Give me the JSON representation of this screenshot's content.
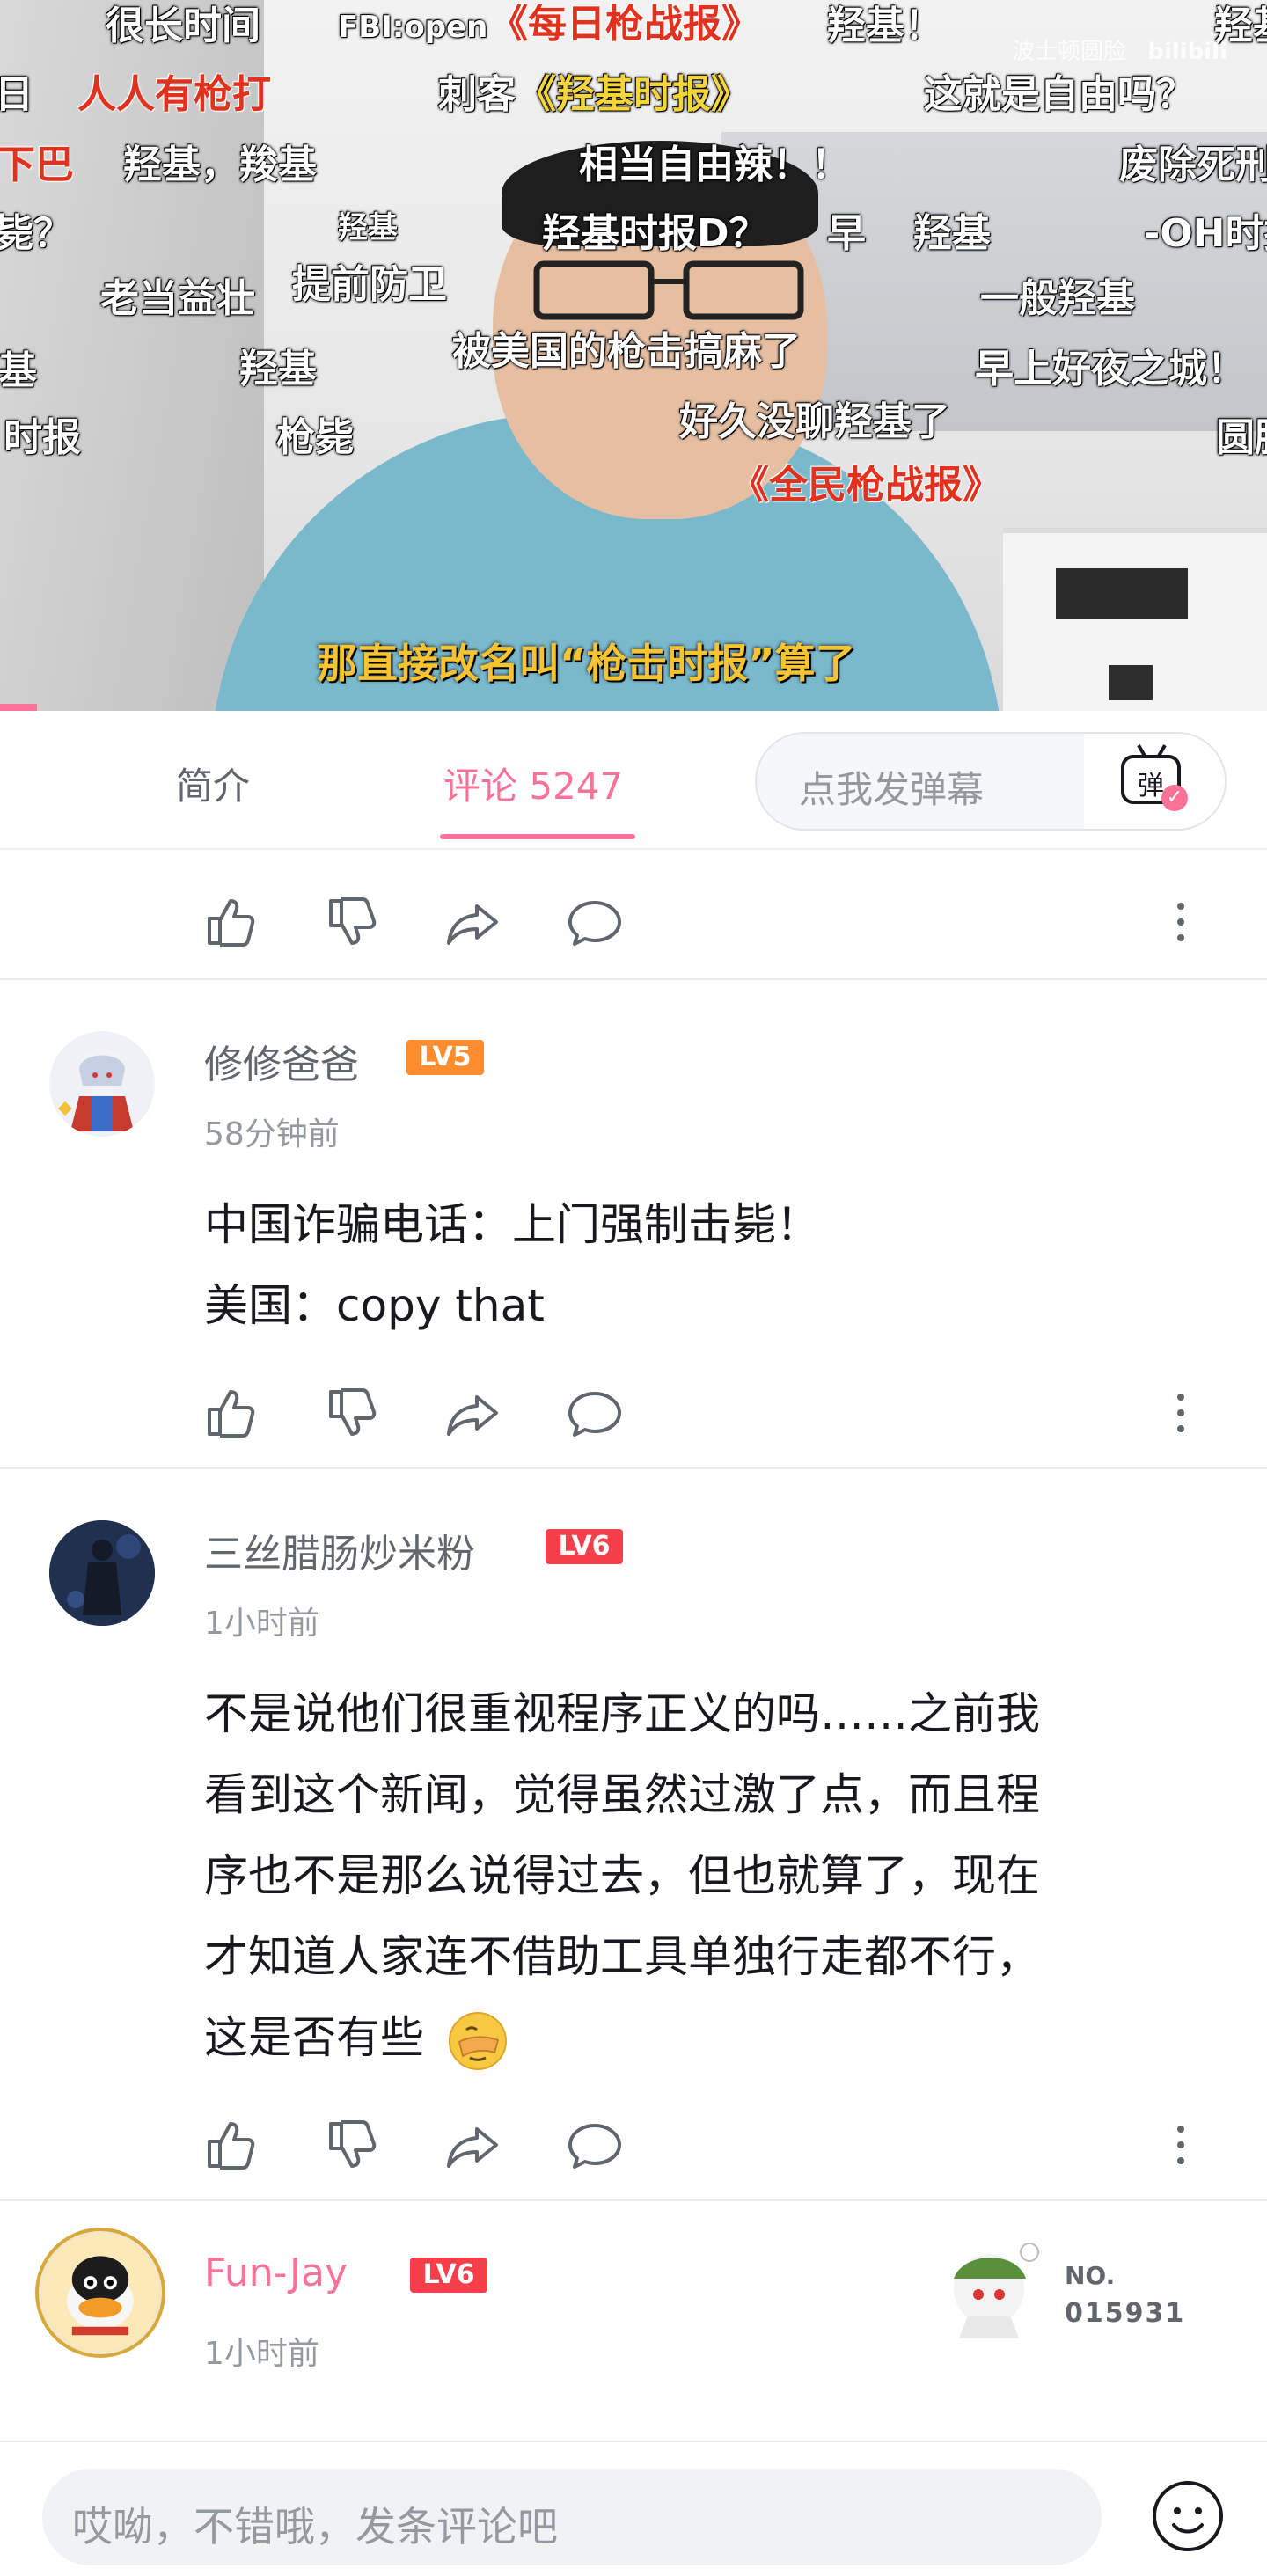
{
  "video": {
    "danmaku": [
      {
        "text": "很长时间",
        "cls": ""
      },
      {
        "text": "FBI:open",
        "cls": "small"
      },
      {
        "text": "《每日枪战报》",
        "cls": "red"
      },
      {
        "text": "羟基！",
        "cls": ""
      },
      {
        "text": "羟基",
        "cls": ""
      },
      {
        "text": "人人有枪打",
        "cls": "red"
      },
      {
        "text": "刺客",
        "cls": ""
      },
      {
        "text": "《羟基时报》",
        "cls": "yellow"
      },
      {
        "text": "这就是自由吗？",
        "cls": ""
      },
      {
        "text": "下巴",
        "cls": "red"
      },
      {
        "text": "羟基，羧基",
        "cls": ""
      },
      {
        "text": "相当自由辣！！",
        "cls": ""
      },
      {
        "text": "废除死刑",
        "cls": ""
      },
      {
        "text": "羟基",
        "cls": "small"
      },
      {
        "text": "羟基时报D？",
        "cls": ""
      },
      {
        "text": "早",
        "cls": ""
      },
      {
        "text": "羟基",
        "cls": ""
      },
      {
        "text": "-OH时报",
        "cls": ""
      },
      {
        "text": "老当益壮",
        "cls": ""
      },
      {
        "text": "提前防卫",
        "cls": ""
      },
      {
        "text": "一般羟基",
        "cls": ""
      },
      {
        "text": "羟基",
        "cls": ""
      },
      {
        "text": "被美国的枪击搞麻了",
        "cls": ""
      },
      {
        "text": "早上好夜之城！",
        "cls": ""
      },
      {
        "text": "时报",
        "cls": ""
      },
      {
        "text": "枪毙",
        "cls": ""
      },
      {
        "text": "好久没聊羟基了",
        "cls": ""
      },
      {
        "text": "圆脸",
        "cls": ""
      },
      {
        "text": "《全民枪战报》",
        "cls": "red"
      },
      {
        "text": "基",
        "cls": ""
      },
      {
        "text": "毙？",
        "cls": ""
      },
      {
        "text": "日",
        "cls": ""
      }
    ],
    "watermark": "波士顿圆脸",
    "watermark_logo": "bilibili",
    "subtitle": "那直接改名叫“枪击时报”算了"
  },
  "tabs": {
    "intro": "简介",
    "comments": "评论 5247",
    "danmaku_placeholder": "点我发弹幕",
    "danmaku_button": "弹"
  },
  "comments": [
    {
      "user": "修修爸爸",
      "level": "LV5",
      "time": "58分钟前",
      "lines": [
        "中国诈骗电话：上门强制击毙！",
        "美国：copy that"
      ]
    },
    {
      "user": "三丝腊肠炒米粉",
      "level": "LV6",
      "time": "1小时前",
      "lines": [
        "不是说他们很重视程序正义的吗……之前我",
        "看到这个新闻，觉得虽然过激了点，而且程",
        "序也不是那么说得过去，但也就算了，现在",
        "才知道人家连不借助工具单独行走都不行，",
        "这是否有些"
      ]
    },
    {
      "user": "Fun-Jay",
      "level": "LV6",
      "time": "1小时前",
      "badge_no_label": "NO.",
      "badge_no_value": "015931"
    }
  ],
  "bottom": {
    "placeholder": "哎呦，不错哦，发条评论吧"
  },
  "colors": {
    "accent": "#fb7299",
    "level5": "#ff8c2e",
    "level6": "#f5404c",
    "subtitle": "#f6c431"
  }
}
